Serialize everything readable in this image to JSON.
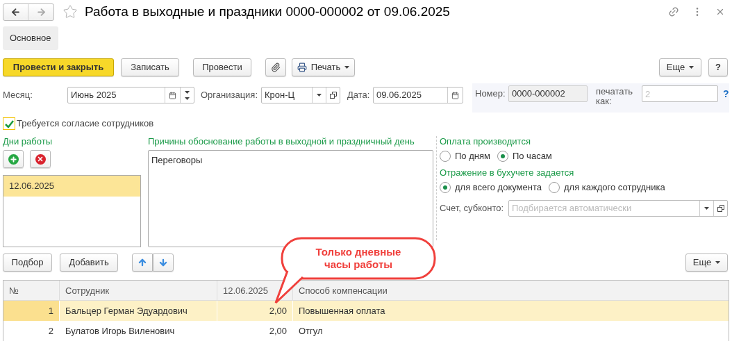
{
  "window": {
    "title": "Работа в выходные и праздники 0000-000002 от 09.06.2025"
  },
  "tabs": [
    {
      "label": "Основное",
      "selected": true
    }
  ],
  "toolbar": [
    {
      "kind": "primary",
      "label": "Провести и закрыть"
    },
    {
      "kind": "default",
      "label": "Записать"
    },
    {
      "kind": "default",
      "label": "Провести"
    },
    {
      "kind": "attach"
    },
    {
      "kind": "print",
      "label": "Печать"
    }
  ],
  "toolbar_right": {
    "more": "Еще",
    "help": "?"
  },
  "fields": {
    "month": {
      "label": "Месяц:",
      "value": "Июнь 2025"
    },
    "organization": {
      "label": "Организация:",
      "value": "Крон-Ц"
    },
    "date": {
      "label": "Дата:",
      "value": "09.06.2025"
    },
    "number": {
      "label": "Номер:",
      "value": "0000-000002"
    },
    "print_as": {
      "label": "печатать как:",
      "placeholder": "2",
      "help": "?"
    }
  },
  "consent": {
    "label": "Требуется согласие сотрудников",
    "checked": true
  },
  "work_days": {
    "title": "Дни работы",
    "items": [
      {
        "value": "12.06.2025",
        "selected": true
      }
    ]
  },
  "reasons": {
    "title": "Причины обоснование работы в выходной и праздничный день",
    "value": "Переговоры"
  },
  "payment": {
    "title": "Оплата производится",
    "options": [
      {
        "label": "По дням",
        "selected": false
      },
      {
        "label": "По часам",
        "selected": true
      }
    ]
  },
  "accounting": {
    "title": "Отражение в бухучете задается",
    "options": [
      {
        "label": "для всего документа",
        "selected": true
      },
      {
        "label": "для каждого сотрудника",
        "selected": false
      }
    ]
  },
  "account": {
    "label": "Счет, субконто:",
    "placeholder": "Подбирается автоматически"
  },
  "table_toolbar": {
    "buttons": [
      "Подбор",
      "Добавить"
    ],
    "more": "Еще"
  },
  "table": {
    "columns": [
      "№",
      "Сотрудник",
      "12.06.2025",
      "Способ компенсации"
    ],
    "rows": [
      {
        "number": "1",
        "employee": "Бальцер Герман Эдуардович",
        "hours": "2,00",
        "compensation": "Повышенная оплата",
        "selected": true
      },
      {
        "number": "2",
        "employee": "Булатов Игорь Виленович",
        "hours": "2,00",
        "compensation": "Отгул",
        "selected": false
      }
    ]
  },
  "callout": {
    "text": "Только дневные часы работы"
  }
}
